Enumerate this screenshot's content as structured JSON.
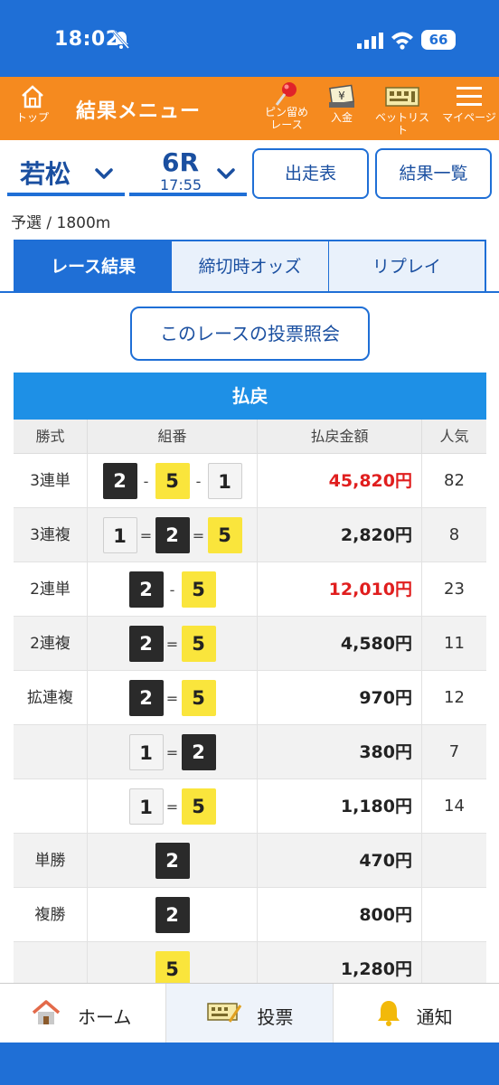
{
  "status": {
    "time": "18:02",
    "battery": "66"
  },
  "nav": {
    "top_label": "トップ",
    "title": "結果メニュー",
    "pin_label_1": "ピン留め",
    "pin_label_2": "レース",
    "deposit_label": "入金",
    "betlist_label": "ベットリスト",
    "mypage_label": "マイページ"
  },
  "race": {
    "venue": "若松",
    "race_number": "6R",
    "race_time": "17:55",
    "entry_list_button": "出走表",
    "results_list_button": "結果一覧",
    "info": "予選 / 1800m"
  },
  "tabs": [
    "レース結果",
    "締切時オッズ",
    "リプレイ"
  ],
  "vote_button": "このレースの投票照会",
  "payout": {
    "heading": "払戻",
    "columns": [
      "勝式",
      "組番",
      "払戻金額",
      "人気"
    ],
    "rows": [
      {
        "type": "3連単",
        "combo": [
          "2",
          "5",
          "1"
        ],
        "sep": "-",
        "amount": "45,820円",
        "pop": "82",
        "highlight": true
      },
      {
        "type": "3連複",
        "combo": [
          "1",
          "2",
          "5"
        ],
        "sep": "=",
        "amount": "2,820円",
        "pop": "8",
        "highlight": false
      },
      {
        "type": "2連単",
        "combo": [
          "2",
          "5"
        ],
        "sep": "-",
        "amount": "12,010円",
        "pop": "23",
        "highlight": true
      },
      {
        "type": "2連複",
        "combo": [
          "2",
          "5"
        ],
        "sep": "=",
        "amount": "4,580円",
        "pop": "11",
        "highlight": false
      },
      {
        "type": "拡連複",
        "combo": [
          "2",
          "5"
        ],
        "sep": "=",
        "amount": "970円",
        "pop": "12",
        "highlight": false
      },
      {
        "type": "",
        "combo": [
          "1",
          "2"
        ],
        "sep": "=",
        "amount": "380円",
        "pop": "7",
        "highlight": false
      },
      {
        "type": "",
        "combo": [
          "1",
          "5"
        ],
        "sep": "=",
        "amount": "1,180円",
        "pop": "14",
        "highlight": false
      },
      {
        "type": "単勝",
        "combo": [
          "2"
        ],
        "sep": "",
        "amount": "470円",
        "pop": "",
        "highlight": false
      },
      {
        "type": "複勝",
        "combo": [
          "2"
        ],
        "sep": "",
        "amount": "800円",
        "pop": "",
        "highlight": false
      },
      {
        "type": "",
        "combo": [
          "5"
        ],
        "sep": "",
        "amount": "1,280円",
        "pop": "",
        "highlight": false
      }
    ]
  },
  "bottom_nav": {
    "home": "ホーム",
    "vote": "投票",
    "notify": "通知"
  },
  "colors": {
    "primary": "#1f6fd6",
    "orange": "#f58a1f",
    "payout_red": "#e01e1e",
    "boat2": "#2a2a2a",
    "boat5": "#fae53c"
  }
}
